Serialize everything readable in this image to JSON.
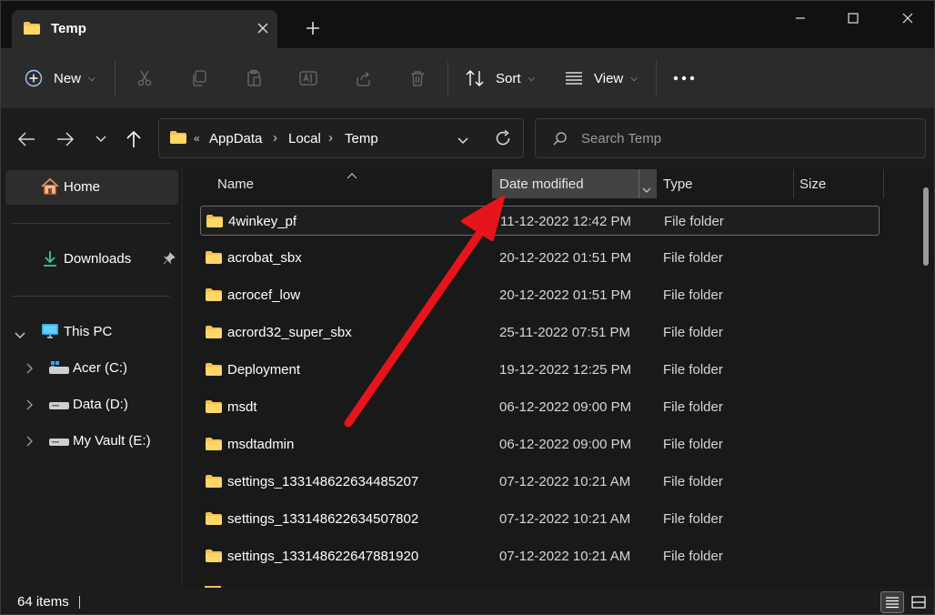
{
  "tab": {
    "title": "Temp",
    "close_icon": "close-icon"
  },
  "window_controls": {
    "minimize": "minimize-icon",
    "maximize": "maximize-icon",
    "close": "close-icon"
  },
  "toolbar": {
    "new_label": "New",
    "sort_label": "Sort",
    "view_label": "View",
    "icons": [
      "cut-icon",
      "copy-icon",
      "paste-icon",
      "rename-icon",
      "share-icon",
      "delete-icon",
      "more-icon"
    ]
  },
  "address": {
    "overflow": "«",
    "crumbs": [
      "AppData",
      "Local",
      "Temp"
    ],
    "separator": "›"
  },
  "search": {
    "placeholder": "Search Temp"
  },
  "sidebar": {
    "home": "Home",
    "downloads": "Downloads",
    "this_pc": "This PC",
    "drives": [
      "Acer (C:)",
      "Data (D:)",
      "My Vault (E:)"
    ]
  },
  "columns": {
    "name": "Name",
    "date": "Date modified",
    "type": "Type",
    "size": "Size"
  },
  "files": [
    {
      "name": "4winkey_pf",
      "date": "11-12-2022 12:42 PM",
      "type": "File folder"
    },
    {
      "name": "acrobat_sbx",
      "date": "20-12-2022 01:51 PM",
      "type": "File folder"
    },
    {
      "name": "acrocef_low",
      "date": "20-12-2022 01:51 PM",
      "type": "File folder"
    },
    {
      "name": "acrord32_super_sbx",
      "date": "25-11-2022 07:51 PM",
      "type": "File folder"
    },
    {
      "name": "Deployment",
      "date": "19-12-2022 12:25 PM",
      "type": "File folder"
    },
    {
      "name": "msdt",
      "date": "06-12-2022 09:00 PM",
      "type": "File folder"
    },
    {
      "name": "msdtadmin",
      "date": "06-12-2022 09:00 PM",
      "type": "File folder"
    },
    {
      "name": "settings_133148622634485207",
      "date": "07-12-2022 10:21 AM",
      "type": "File folder"
    },
    {
      "name": "settings_133148622634507802",
      "date": "07-12-2022 10:21 AM",
      "type": "File folder"
    },
    {
      "name": "settings_133148622647881920",
      "date": "07-12-2022 10:21 AM",
      "type": "File folder"
    }
  ],
  "status": {
    "item_count": "64 items"
  },
  "colors": {
    "folder": "#f4c24d",
    "annotation_arrow": "#e8141c",
    "accent": "#4aa3ff"
  }
}
